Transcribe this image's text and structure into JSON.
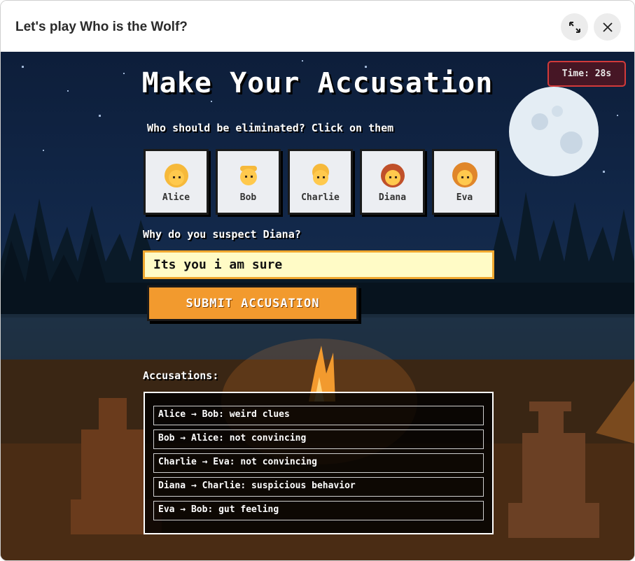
{
  "window": {
    "title": "Let's play Who is the Wolf?"
  },
  "game": {
    "heading": "Make Your Accusation",
    "timer": "Time: 28s",
    "prompt": "Who should be eliminated? Click on them",
    "players": [
      {
        "name": "Alice",
        "icon": "woman-face-icon",
        "hair": "#f6b93b"
      },
      {
        "name": "Bob",
        "icon": "man-face-icon",
        "hair": "#f6b93b"
      },
      {
        "name": "Charlie",
        "icon": "person-face-icon",
        "hair": "#f6b93b"
      },
      {
        "name": "Diana",
        "icon": "red-haired-woman-icon",
        "hair": "#c0502a"
      },
      {
        "name": "Eva",
        "icon": "curly-haired-woman-icon",
        "hair": "#e0862a"
      }
    ],
    "why_label": "Why do you suspect Diana?",
    "reason_value": "Its you i am sure",
    "submit_label": "SUBMIT ACCUSATION",
    "accusations_label": "Accusations:",
    "accusations": [
      "Alice → Bob: weird clues",
      "Bob → Alice: not convincing",
      "Charlie → Eva: not convincing",
      "Diana → Charlie: suspicious behavior",
      "Eva → Bob: gut feeling"
    ]
  },
  "colors": {
    "accent": "#f29a2e",
    "timer_border": "#d23a3a",
    "input_bg": "#fffbc6"
  }
}
